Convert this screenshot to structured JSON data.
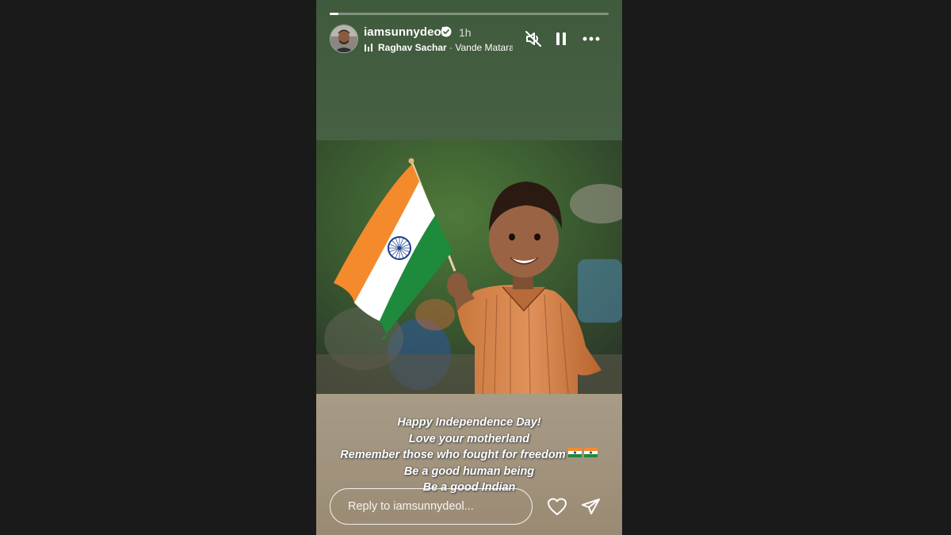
{
  "story": {
    "progress": 0.03,
    "username": "iamsunnydeol",
    "verified": true,
    "time": "1h",
    "music": {
      "artist": "Raghav Sachar",
      "separator": " · ",
      "track": "Vande Mataram"
    },
    "icons": {
      "mute": "speaker-muted-icon",
      "pause": "pause-icon",
      "more": "more-options-icon"
    },
    "image": {
      "subject": "boy-holding-indian-flag",
      "flag_colors": {
        "saffron": "#f58a2c",
        "white": "#ffffff",
        "green": "#1e8a3c",
        "chakra": "#1b3d8f"
      }
    },
    "caption": {
      "lines": [
        "Happy Independence Day!",
        "Love your motherland",
        "Remember those who fought for freedom",
        "Be a good human being",
        "Be a good Indian"
      ]
    },
    "reply": {
      "placeholder": "Reply to iamsunnydeol..."
    }
  },
  "colors": {
    "page_background": "#1a1a1a",
    "story_top": "#3f5a3c",
    "story_bottom": "#9a8a74",
    "text": "#ffffff"
  }
}
